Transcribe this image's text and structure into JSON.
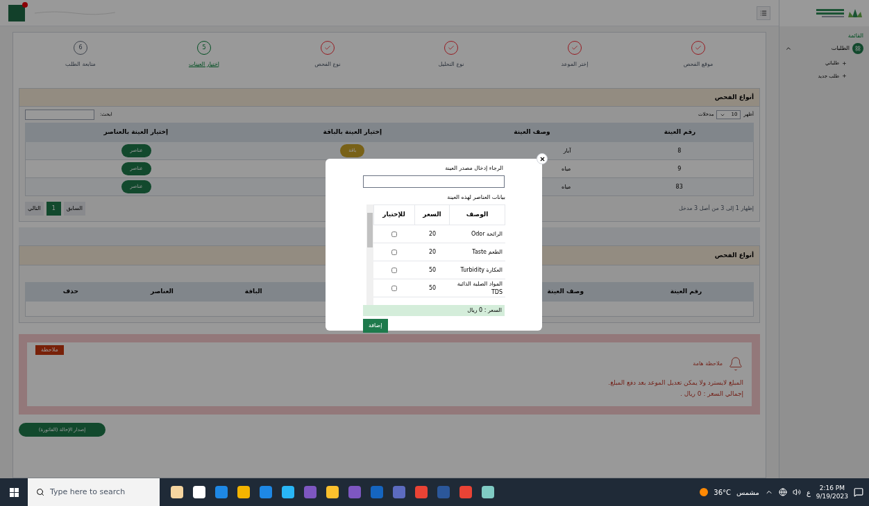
{
  "sidebar": {
    "heading": "القائمة",
    "items": [
      {
        "label": "الطلبات",
        "expanded": true,
        "children": [
          {
            "label": "طلباتي"
          },
          {
            "label": "طلب جديد"
          }
        ]
      }
    ]
  },
  "steps": [
    {
      "label": "موقع الفحص",
      "kind": "done"
    },
    {
      "label": "إختر الموعد",
      "kind": "done"
    },
    {
      "label": "نوع التحليل",
      "kind": "done"
    },
    {
      "label": "نوع الفحص",
      "kind": "done"
    },
    {
      "label": "إختيار العينات",
      "kind": "current",
      "number": "5"
    },
    {
      "label": "متابعة الطلب",
      "kind": "pending",
      "number": "6"
    }
  ],
  "samples_panel": {
    "title": "أنواع الفحص",
    "show_label": "أظهر",
    "page_size": "10",
    "entries_label": "مدخلات",
    "search_label": "ابحث:",
    "columns": [
      "رقم العينة",
      "وصف العينة",
      "إختيار العينة بالباقة",
      "إختيار العينة بالعناصر"
    ],
    "rows": [
      {
        "number": "8",
        "description": "آبار",
        "package_button": "باقة",
        "elements_button": "عناصر"
      },
      {
        "number": "9",
        "description": "مياه",
        "elements_button": "عناصر"
      },
      {
        "number": "83",
        "description": "مياه",
        "elements_button": "عناصر"
      }
    ],
    "info": "إظهار 1 إلى 3 من أصل 3 مدخل",
    "previous": "السابق",
    "pages": [
      {
        "label": "1",
        "selected": true
      }
    ],
    "next": "التالي"
  },
  "selected_panel": {
    "title": "أنواع الفحص",
    "columns": [
      "رقم العينة",
      "وصف العينة",
      "الباقة",
      "العناصر",
      "حذف"
    ]
  },
  "note": {
    "badge": "ملاحظة",
    "title": "ملاحظة هامة",
    "lines": [
      "المبلغ لايسترد ولا يمكن تعديل الموعد بعد دفع المبلغ.",
      "إجمالي السعر : 0 ريال ."
    ]
  },
  "invoice_button": "إصدار الإحالة (الفاتورة)",
  "modal": {
    "source_label": "الرجاء إدخال مصدر العينة",
    "elements_title": "بيانات العناصر لهذه العينة",
    "columns": [
      "الوصف",
      "السعر",
      "للإختيار"
    ],
    "rows": [
      {
        "description": "الرائحة Odor",
        "price": "20",
        "checked": false
      },
      {
        "description": "الطعم Taste",
        "price": "20",
        "checked": false
      },
      {
        "description": "العكارة Turbidity",
        "price": "50",
        "checked": false
      },
      {
        "description": "المواد الصلبة الذائبة TDS",
        "price": "50",
        "checked": false
      }
    ],
    "total": "السعر : 0 ريال",
    "add_button": "إضافة"
  },
  "taskbar": {
    "search_placeholder": "Type here to search",
    "weather": "36°C",
    "weather_label": "مشمس",
    "language": "ع",
    "time": "2:16 PM",
    "date": "9/19/2023"
  }
}
